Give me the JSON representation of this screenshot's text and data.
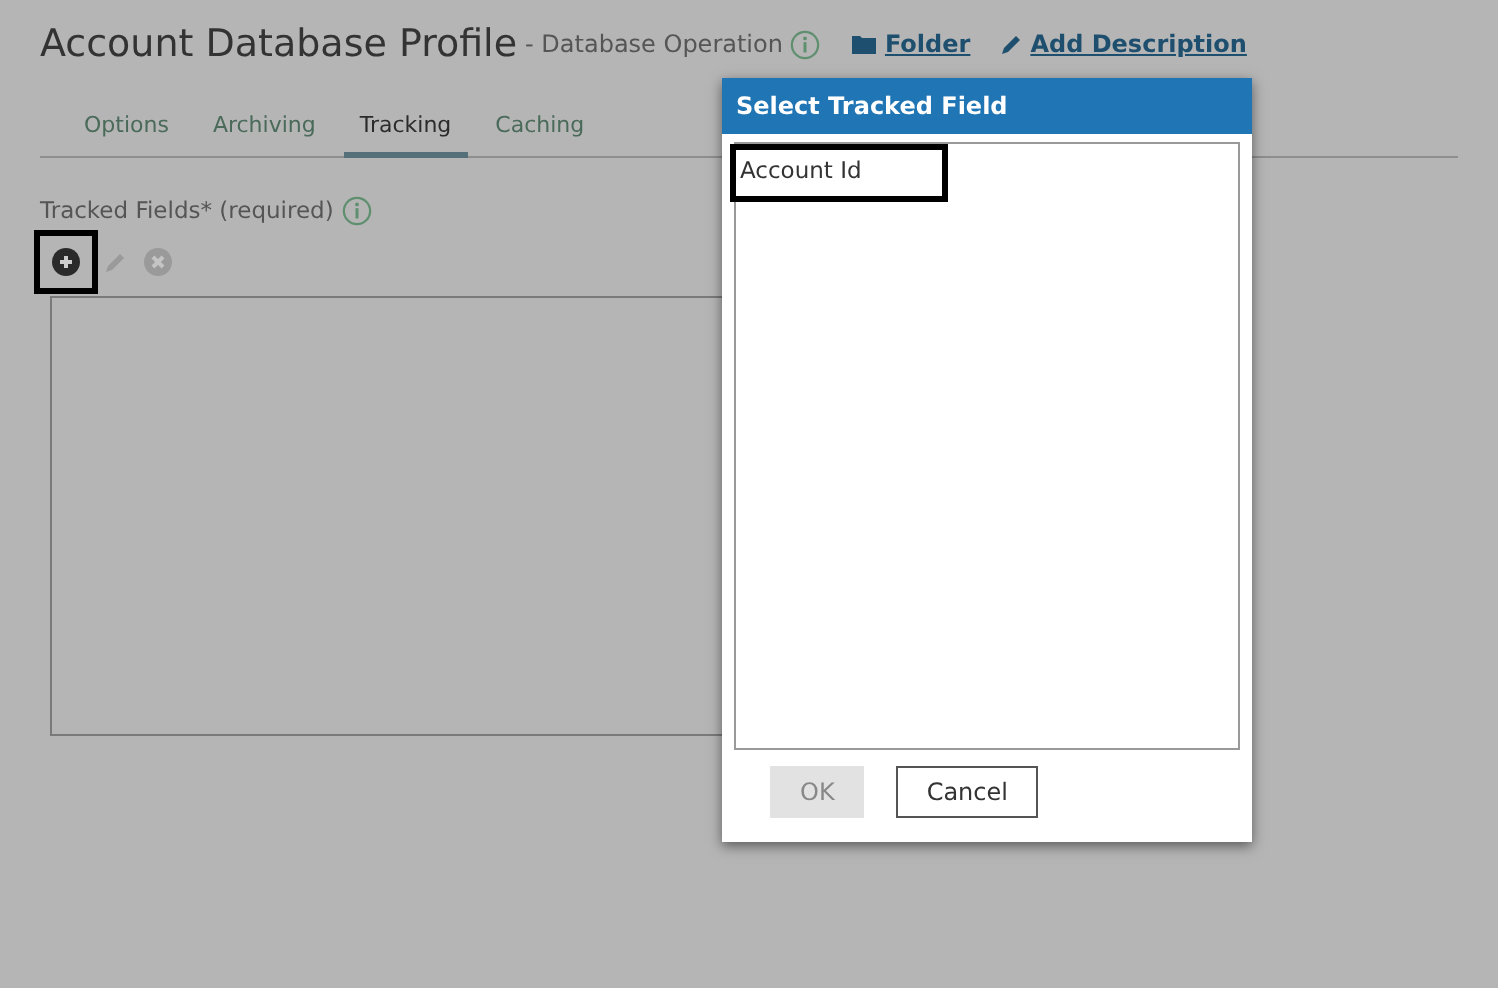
{
  "header": {
    "title": "Account Database Profile",
    "subtitle": "- Database Operation",
    "links": [
      {
        "label": "Folder",
        "kind": "folder"
      },
      {
        "label": "Add Description",
        "kind": "pencil"
      }
    ]
  },
  "tabs": [
    {
      "label": "Options",
      "selected": false
    },
    {
      "label": "Archiving",
      "selected": false
    },
    {
      "label": "Tracking",
      "selected": true
    },
    {
      "label": "Caching",
      "selected": false
    }
  ],
  "tracked_fields": {
    "label": "Tracked Fields* (required)",
    "toolbar": [
      {
        "kind": "add",
        "disabled": false,
        "highlighted": true
      },
      {
        "kind": "edit",
        "disabled": true,
        "highlighted": false
      },
      {
        "kind": "remove",
        "disabled": true,
        "highlighted": false
      }
    ]
  },
  "dialog": {
    "title": "Select Tracked Field",
    "items": [
      {
        "label": "Account Id",
        "selected": false,
        "highlighted": true
      }
    ],
    "buttons": [
      {
        "label": "OK",
        "disabled": true
      },
      {
        "label": "Cancel",
        "disabled": false
      }
    ]
  }
}
